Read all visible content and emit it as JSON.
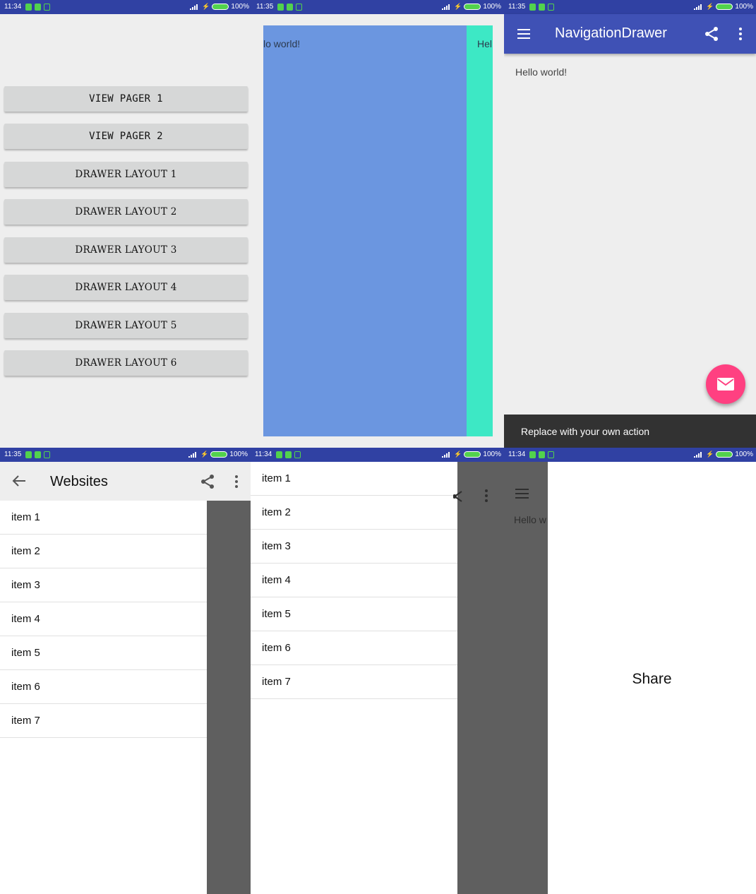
{
  "panels": [
    {
      "status": {
        "time": "11:34",
        "battery": "100%"
      },
      "buttons": [
        "VIEW PAGER 1",
        "VIEW PAGER 2",
        "DRAWER LAYOUT 1",
        "DRAWER LAYOUT 2",
        "DRAWER LAYOUT 3",
        "DRAWER LAYOUT 4",
        "DRAWER LAYOUT 5",
        "DRAWER LAYOUT 6"
      ]
    },
    {
      "status": {
        "time": "11:35",
        "battery": "100%"
      },
      "page_text_left": "lo world!",
      "page_text_right": "Hel",
      "colors": {
        "page1": "#6b96e0",
        "page2": "#3de8c5"
      }
    },
    {
      "status": {
        "time": "11:35",
        "battery": "100%"
      },
      "toolbar_title": "NavigationDrawer",
      "content_text": "Hello world!",
      "snackbar_text": "Replace with your own action",
      "colors": {
        "primary": "#3f51b5",
        "accent": "#ff4081"
      },
      "icons": {
        "menu": "menu-icon",
        "share": "share-icon",
        "more": "more-vert-icon",
        "fab": "email-icon"
      }
    },
    {
      "status": {
        "time": "11:35",
        "battery": "100%"
      },
      "toolbar_title": "Websites",
      "items": [
        "item 1",
        "item 2",
        "item 3",
        "item 4",
        "item 5",
        "item 6",
        "item 7"
      ],
      "icons": {
        "back": "arrow-back-icon",
        "share": "share-icon",
        "more": "more-vert-icon"
      }
    },
    {
      "status": {
        "time": "11:34",
        "battery": "100%"
      },
      "items": [
        "item 1",
        "item 2",
        "item 3",
        "item 4",
        "item 5",
        "item 6",
        "item 7"
      ]
    },
    {
      "status": {
        "time": "11:34",
        "battery": "100%"
      },
      "background_text": "Hello w",
      "sheet_text": "Share"
    }
  ]
}
